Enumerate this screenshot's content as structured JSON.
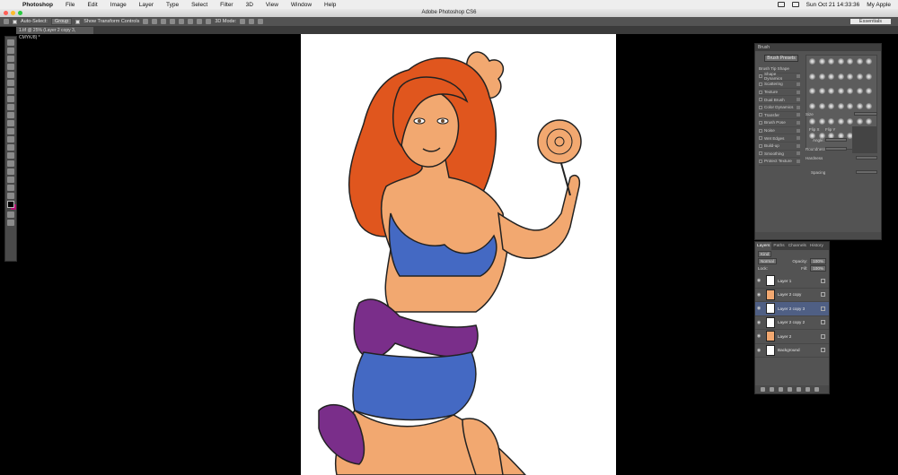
{
  "menubar": {
    "app": "Photoshop",
    "items": [
      "File",
      "Edit",
      "Image",
      "Layer",
      "Type",
      "Select",
      "Filter",
      "3D",
      "View",
      "Window",
      "Help"
    ],
    "clock": "Sun Oct 21  14:33:36",
    "user": "My Apple"
  },
  "window": {
    "title": "Adobe Photoshop CS6"
  },
  "options": {
    "auto_select_label": "Auto-Select:",
    "auto_select_value": "Group",
    "show_transform_label": "Show Transform Controls",
    "mode_3d": "3D Mode:",
    "workspace": "Essentials"
  },
  "document": {
    "tab": "1.tif @ 25% (Layer 2 copy 3, CMYK/8) *"
  },
  "brush_panel": {
    "title": "Brush",
    "presets_button": "Brush Presets",
    "options": [
      "Brush Tip Shape",
      "Shape Dynamics",
      "Scattering",
      "Texture",
      "Dual Brush",
      "Color Dynamics",
      "Transfer",
      "Brush Pose",
      "Noise",
      "Wet Edges",
      "Build-up",
      "Smoothing",
      "Protect Texture"
    ],
    "size_label": "Size",
    "flip_x": "Flip X",
    "flip_y": "Flip Y",
    "angle_label": "Angle:",
    "roundness_label": "Roundness:",
    "hardness_label": "Hardness",
    "spacing_label": "Spacing"
  },
  "layers_panel": {
    "tabs": [
      "Layers",
      "Paths",
      "Channels",
      "History"
    ],
    "kind": "Kind",
    "blend_mode": "Normal",
    "opacity_label": "Opacity:",
    "opacity": "100%",
    "lock_label": "Lock:",
    "fill_label": "Fill:",
    "fill": "100%",
    "layers": [
      {
        "name": "Layer 1",
        "selected": false
      },
      {
        "name": "Layer 2 copy",
        "selected": false
      },
      {
        "name": "Layer 2 copy 3",
        "selected": true
      },
      {
        "name": "Layer 2 copy 2",
        "selected": false
      },
      {
        "name": "Layer 2",
        "selected": false
      },
      {
        "name": "Background",
        "selected": false
      }
    ]
  },
  "colors": {
    "hair": "#e0561e",
    "skin": "#f2a870",
    "outfit": "#4469c3",
    "sash": "#7a2e8a",
    "ps_panel": "#535353"
  }
}
